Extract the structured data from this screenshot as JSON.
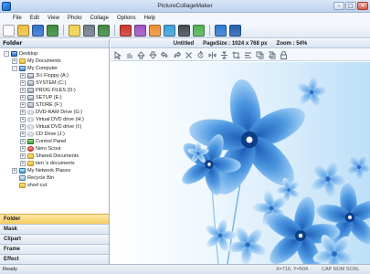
{
  "window": {
    "title": "PictureCollageMaker"
  },
  "menu": [
    "File",
    "Edit",
    "View",
    "Photo",
    "Collage",
    "Options",
    "Help"
  ],
  "toolbar_icons": [
    {
      "name": "new-icon",
      "color": "#ffffff"
    },
    {
      "name": "open-icon",
      "color": "#f0c040"
    },
    {
      "name": "save-icon",
      "color": "#2f6fd0"
    },
    {
      "name": "save-as-icon",
      "color": "#3a8a3a"
    },
    {
      "name": "page-icon",
      "color": "#f2d34a"
    },
    {
      "name": "print-icon",
      "color": "#707a88"
    },
    {
      "name": "share-icon",
      "color": "#3d8a3d"
    },
    {
      "name": "photo-icon",
      "color": "#d0332a"
    },
    {
      "name": "mask-icon",
      "color": "#a050c0"
    },
    {
      "name": "text-icon",
      "color": "#f09030"
    },
    {
      "name": "clipart-icon",
      "color": "#3aa0d8"
    },
    {
      "name": "frame-icon",
      "color": "#404850"
    },
    {
      "name": "effect-icon",
      "color": "#50b050"
    },
    {
      "name": "export-icon",
      "color": "#2a7ad0"
    },
    {
      "name": "help-icon",
      "color": "#1f5fb0"
    }
  ],
  "left_panel": {
    "header": "Folder",
    "tree": [
      {
        "label": "Desktop",
        "level": 0,
        "expander": "-",
        "icon": "desktop"
      },
      {
        "label": "My Documents",
        "level": 1,
        "expander": "+",
        "icon": "folder"
      },
      {
        "label": "My Computer",
        "level": 1,
        "expander": "-",
        "icon": "computer"
      },
      {
        "label": "3½ Floppy (A:)",
        "level": 2,
        "expander": "+",
        "icon": "drive"
      },
      {
        "label": "SYSTEM (C:)",
        "level": 2,
        "expander": "+",
        "icon": "drive"
      },
      {
        "label": "PROG FILES (D:)",
        "level": 2,
        "expander": "+",
        "icon": "drive"
      },
      {
        "label": "SETUP (E:)",
        "level": 2,
        "expander": "+",
        "icon": "drive"
      },
      {
        "label": "STORE (F:)",
        "level": 2,
        "expander": "+",
        "icon": "drive"
      },
      {
        "label": "DVD-RAM Drive (G:)",
        "level": 2,
        "expander": "+",
        "icon": "cd"
      },
      {
        "label": "Virtual DVD drive (H:)",
        "level": 2,
        "expander": "+",
        "icon": "cd"
      },
      {
        "label": "Virtual DVD drive (I:)",
        "level": 2,
        "expander": "+",
        "icon": "cd"
      },
      {
        "label": "CD Drive (J:)",
        "level": 2,
        "expander": "+",
        "icon": "cd"
      },
      {
        "label": "Control Panel",
        "level": 2,
        "expander": "+",
        "icon": "panel"
      },
      {
        "label": "Nero Scout",
        "level": 2,
        "expander": "+",
        "icon": "nero"
      },
      {
        "label": "Shared Documents",
        "level": 2,
        "expander": "+",
        "icon": "folder"
      },
      {
        "label": "tien 's documents",
        "level": 2,
        "expander": "+",
        "icon": "folder"
      },
      {
        "label": "My Network Places",
        "level": 1,
        "expander": "+",
        "icon": "network"
      },
      {
        "label": "Recycle Bin",
        "level": 1,
        "expander": "",
        "icon": "bin"
      },
      {
        "label": "short cut",
        "level": 1,
        "expander": "",
        "icon": "folder"
      }
    ],
    "accordion": [
      "Folder",
      "Mask",
      "Clipart",
      "Frame",
      "Effect"
    ],
    "accordion_active": "Folder"
  },
  "info_bar": {
    "doc_name": "Untitled",
    "page_size": "PageSize : 1024 x 768 px",
    "zoom": "Zoom : 54%"
  },
  "edit_tools": [
    "select-icon",
    "hand-icon",
    "move-up-icon",
    "move-down-icon",
    "undo-icon",
    "redo-icon",
    "delete-icon",
    "rotate-icon",
    "flip-horizontal-icon",
    "flip-vertical-icon",
    "crop-icon",
    "align-icon",
    "bring-front-icon",
    "send-back-icon",
    "lock-icon"
  ],
  "status": {
    "text": "Ready",
    "coords": "X=716, Y=504",
    "keys": "CAP  NUM  SCRL"
  },
  "colors": {
    "flower_blue": "#3b86d6",
    "flower_light": "#a9d3f7",
    "accent_active": "#f6cd5e"
  }
}
